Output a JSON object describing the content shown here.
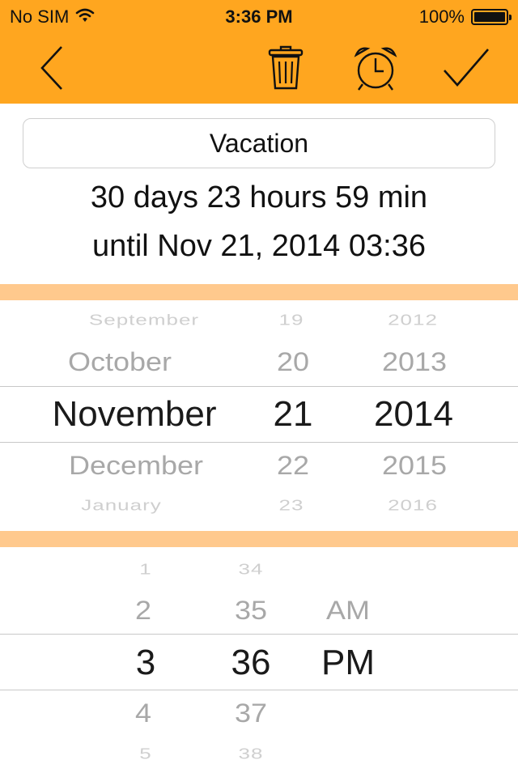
{
  "status_bar": {
    "carrier": "No SIM",
    "time": "3:36 PM",
    "battery": "100%",
    "icons": [
      "wifi-icon",
      "battery-icon"
    ]
  },
  "toolbar": {
    "icons": [
      "back-chevron-icon",
      "trash-icon",
      "alarm-clock-icon",
      "checkmark-icon"
    ],
    "accent_color": "#FFA61F"
  },
  "event": {
    "title": "Vacation",
    "countdown": "30 days 23 hours 59 min",
    "until": "until Nov 21, 2014 03:36"
  },
  "date_picker": {
    "months": [
      "September",
      "October",
      "November",
      "December",
      "January"
    ],
    "days": [
      "19",
      "20",
      "21",
      "22",
      "23"
    ],
    "years": [
      "2012",
      "2013",
      "2014",
      "2015",
      "2016"
    ],
    "selected": {
      "month": "November",
      "day": "21",
      "year": "2014"
    }
  },
  "time_picker": {
    "hours": [
      "1",
      "2",
      "3",
      "4",
      "5"
    ],
    "minutes": [
      "34",
      "35",
      "36",
      "37",
      "38"
    ],
    "periods": [
      "",
      "AM",
      "PM",
      "",
      ""
    ],
    "selected": {
      "hour": "3",
      "minute": "36",
      "period": "PM"
    }
  },
  "colors": {
    "header": "#FFA61F",
    "separator": "#FFC98D",
    "selection_line": "#c8c8c8"
  }
}
